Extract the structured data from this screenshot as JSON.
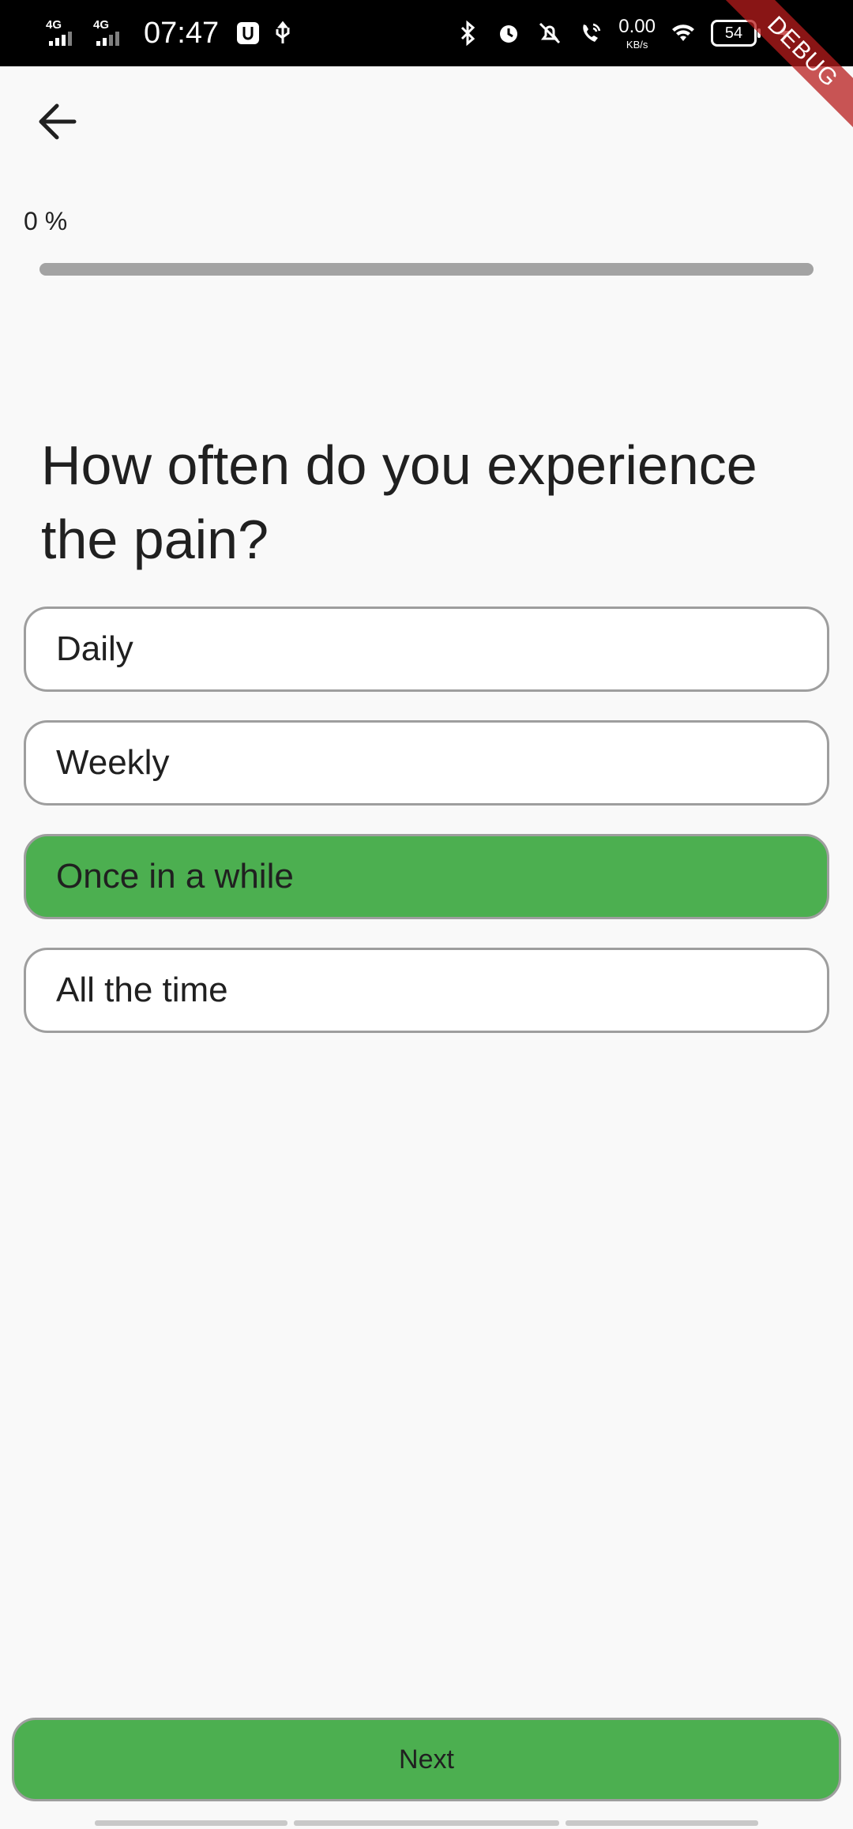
{
  "status_bar": {
    "net1": "4G",
    "net2": "4G",
    "time": "07:47",
    "speed_value": "0.00",
    "speed_unit": "KB/s",
    "battery": "54"
  },
  "debug_banner": "DEBUG",
  "progress": {
    "label": "0 %",
    "value": 0,
    "accent": "#4caf50"
  },
  "question": "How often do you experience the pain?",
  "options": [
    {
      "label": "Daily",
      "selected": false
    },
    {
      "label": "Weekly",
      "selected": false
    },
    {
      "label": "Once in a while",
      "selected": true
    },
    {
      "label": "All the time",
      "selected": false
    }
  ],
  "next_label": "Next",
  "colors": {
    "selected": "#4caf50",
    "border": "#9e9e9e",
    "background": "#f9f9f9"
  }
}
